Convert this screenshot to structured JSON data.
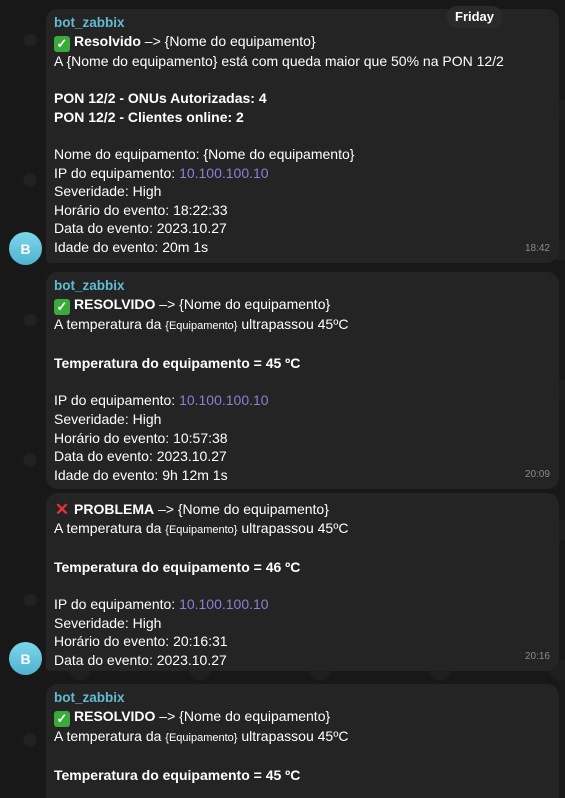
{
  "day_chip": "Friday",
  "avatar_letter": "B",
  "messages": [
    {
      "sender": "bot_zabbix",
      "title_status": "Resolvido",
      "title_rest": " –> {Nome do equipamento}",
      "desc": "A  {Nome do equipamento}   está com queda maior que 50% na PON 12/2",
      "onus": "PON 12/2 - ONUs Autorizadas: 4",
      "clients": "PON 12/2 - Clientes online: 2",
      "name_line": "Nome do equipamento: {Nome do equipamento}",
      "ip_label": "IP do equipamento: ",
      "ip_value": "10.100.100.10",
      "severity": "Severidade: High",
      "event_time": "Horário do evento: 18:22:33",
      "event_date": "Data do evento: 2023.10.27",
      "event_age": "Idade do evento: 20m 1s",
      "time": "18:42"
    },
    {
      "sender": "bot_zabbix",
      "title_status": "RESOLVIDO",
      "title_rest": " –> {Nome do equipamento}",
      "desc_pre": "A temperatura da ",
      "desc_small": "{Equipamento}",
      "desc_post": " ultrapassou 45ºC",
      "temp": "Temperatura do equipamento = 45 ºC",
      "ip_label": "IP do equipamento: ",
      "ip_value": "10.100.100.10",
      "severity": "Severidade: High",
      "event_time": "Horário do evento: 10:57:38",
      "event_date": "Data do evento: 2023.10.27",
      "event_age": "Idade do evento: 9h 12m 1s",
      "time": "20:09"
    },
    {
      "title_status": "PROBLEMA",
      "title_rest": " –> {Nome do equipamento}",
      "desc_pre": "A temperatura da ",
      "desc_small": "{Equipamento}",
      "desc_post": " ultrapassou 45ºC",
      "temp": "Temperatura do equipamento = 46 ºC",
      "ip_label": "IP do equipamento: ",
      "ip_value": "10.100.100.10",
      "severity": "Severidade: High",
      "event_time": "Horário do evento: 20:16:31",
      "event_date": "Data do evento: 2023.10.27",
      "time": "20:16"
    },
    {
      "sender": "bot_zabbix",
      "title_status": "RESOLVIDO",
      "title_rest": " –> {Nome do equipamento}",
      "desc_pre": "A temperatura da ",
      "desc_small": "{Equipamento}",
      "desc_post": " ultrapassou 45ºC",
      "temp": "Temperatura do equipamento = 45 ºC"
    }
  ]
}
